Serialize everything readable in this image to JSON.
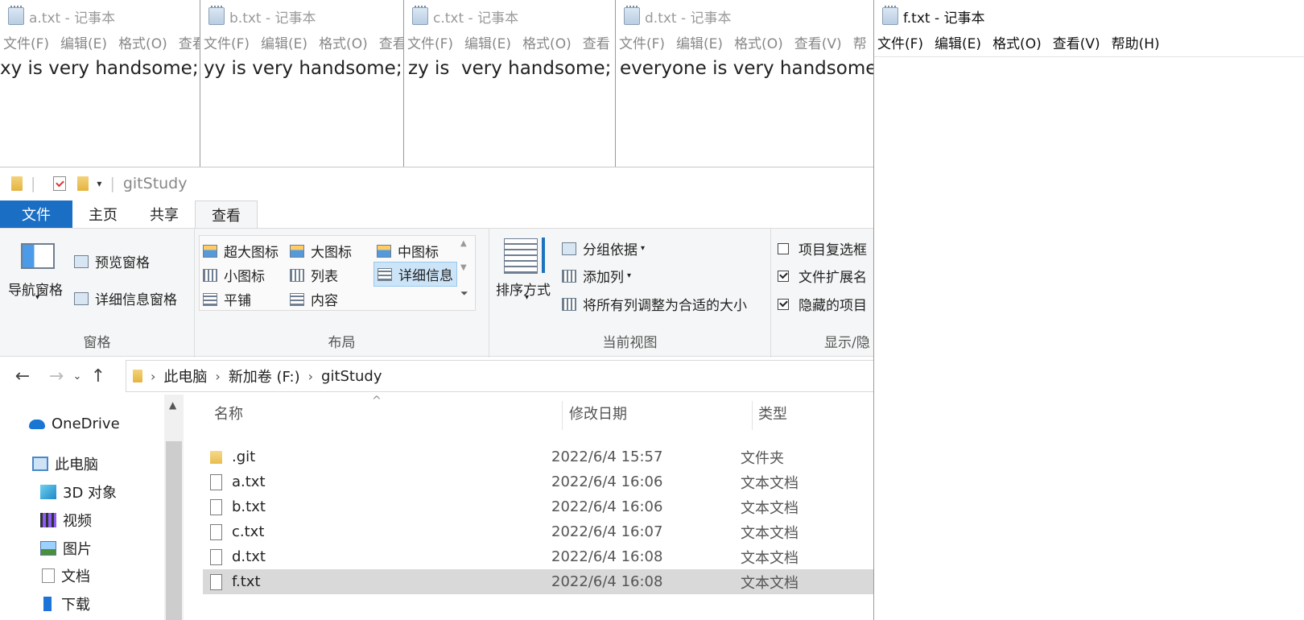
{
  "notepads": [
    {
      "title": "a.txt - 记事本",
      "menu": [
        "文件(F)",
        "编辑(E)",
        "格式(O)",
        "查看"
      ],
      "content": "xy is very handsome;"
    },
    {
      "title": "b.txt - 记事本",
      "menu": [
        "文件(F)",
        "编辑(E)",
        "格式(O)",
        "查看"
      ],
      "content": "yy is very handsome;"
    },
    {
      "title": "c.txt - 记事本",
      "menu": [
        "文件(F)",
        "编辑(E)",
        "格式(O)",
        "查看"
      ],
      "content": "zy is  very handsome;"
    },
    {
      "title": "d.txt - 记事本",
      "menu": [
        "文件(F)",
        "编辑(E)",
        "格式(O)",
        "查看(V)",
        "帮"
      ],
      "content": "everyone is very handsome;"
    },
    {
      "title": "f.txt - 记事本",
      "menu": [
        "文件(F)",
        "编辑(E)",
        "格式(O)",
        "查看(V)",
        "帮助(H)"
      ],
      "content": ""
    }
  ],
  "explorer": {
    "qat_title": "gitStudy",
    "tabs": [
      "文件",
      "主页",
      "共享",
      "查看"
    ],
    "ribbon": {
      "panes": {
        "nav_pane": "导航窗格",
        "preview_pane": "预览窗格",
        "details_pane": "详细信息窗格",
        "label": "窗格"
      },
      "layout": {
        "items": [
          "超大图标",
          "大图标",
          "中图标",
          "小图标",
          "列表",
          "详细信息",
          "平铺",
          "内容"
        ],
        "selected": "详细信息",
        "label": "布局"
      },
      "current_view": {
        "sort_by": "排序方式",
        "group_by": "分组依据",
        "add_column": "添加列",
        "fit_columns": "将所有列调整为合适的大小",
        "label": "当前视图"
      },
      "show_hide": {
        "item_checkboxes": "项目复选框",
        "file_extensions": "文件扩展名",
        "hidden_items": "隐藏的项目",
        "label": "显示/隐",
        "item_checkboxes_checked": false,
        "file_extensions_checked": true,
        "hidden_items_checked": true
      }
    },
    "address": {
      "crumbs": [
        "此电脑",
        "新加卷 (F:)",
        "gitStudy"
      ]
    },
    "nav_tree": [
      "OneDrive",
      "此电脑",
      "3D 对象",
      "视频",
      "图片",
      "文档",
      "下载"
    ],
    "columns": {
      "name": "名称",
      "date": "修改日期",
      "type": "类型"
    },
    "files": [
      {
        "name": ".git",
        "date": "2022/6/4 15:57",
        "type": "文件夹"
      },
      {
        "name": "a.txt",
        "date": "2022/6/4 16:06",
        "type": "文本文档"
      },
      {
        "name": "b.txt",
        "date": "2022/6/4 16:06",
        "type": "文本文档"
      },
      {
        "name": "c.txt",
        "date": "2022/6/4 16:07",
        "type": "文本文档"
      },
      {
        "name": "d.txt",
        "date": "2022/6/4 16:08",
        "type": "文本文档"
      },
      {
        "name": "f.txt",
        "date": "2022/6/4 16:08",
        "type": "文本文档"
      }
    ],
    "selected_file": "f.txt",
    "icons": {
      "back": "back-arrow-icon",
      "forward": "forward-arrow-icon",
      "recent": "chevron-down-icon",
      "up": "up-arrow-icon"
    }
  }
}
